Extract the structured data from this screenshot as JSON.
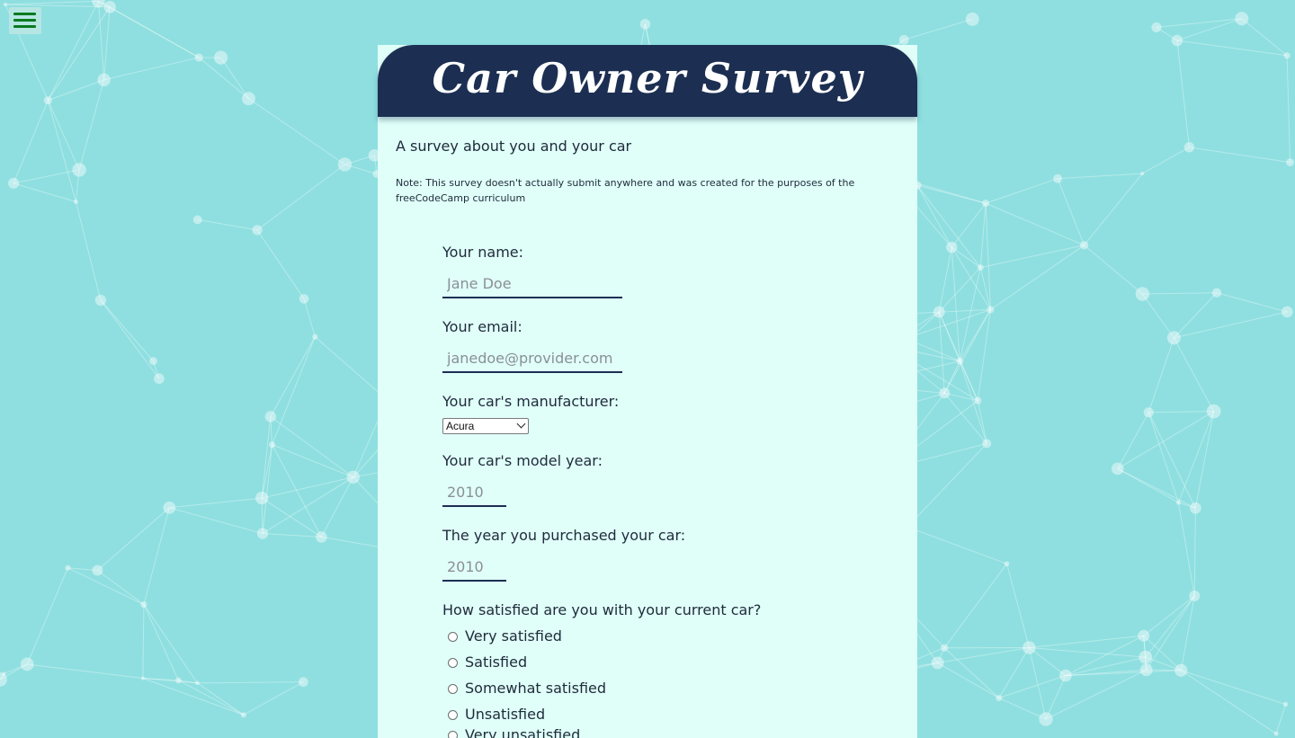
{
  "menu": {
    "icon": "hamburger-menu-icon"
  },
  "header": {
    "title": "Car Owner Survey"
  },
  "intro": {
    "subtitle": "A survey about you and your car",
    "note": "Note: This survey doesn't actually submit anywhere and was created for the purposes of the freeCodeCamp curriculum"
  },
  "form": {
    "name": {
      "label": "Your name:",
      "placeholder": "Jane Doe"
    },
    "email": {
      "label": "Your email:",
      "placeholder": "janedoe@provider.com"
    },
    "manufacturer": {
      "label": "Your car's manufacturer:",
      "selected": "Acura"
    },
    "model_year": {
      "label": "Your car's model year:",
      "placeholder": "2010"
    },
    "purchase_year": {
      "label": "The year you purchased your car:",
      "placeholder": "2010"
    },
    "satisfaction": {
      "label": "How satisfied are you with your current car?",
      "options": [
        "Very satisfied",
        "Satisfied",
        "Somewhat satisfied",
        "Unsatisfied",
        "Very unsatisfied"
      ]
    }
  },
  "colors": {
    "background": "#8fdfe0",
    "card": "#e0fff9",
    "header": "#1c2f52",
    "menu_icon": "#0a7a1e"
  }
}
